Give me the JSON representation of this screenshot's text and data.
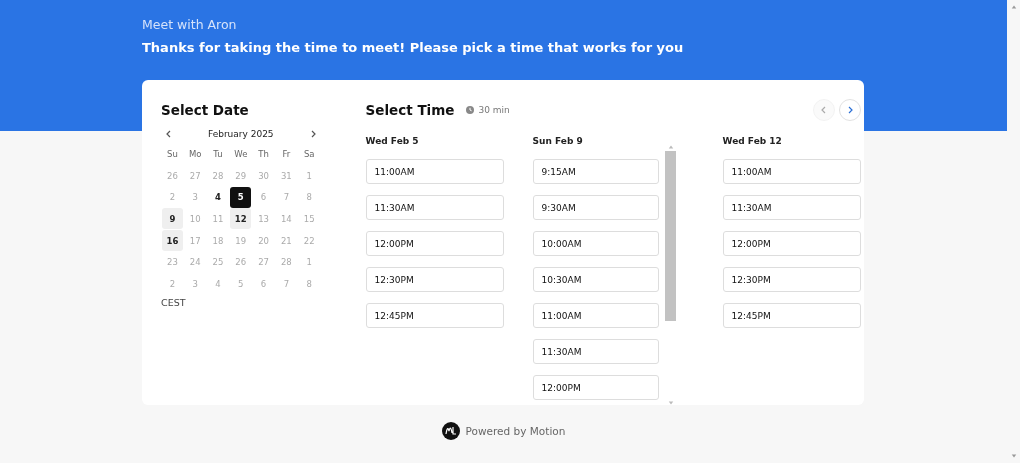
{
  "header": {
    "host": "Meet with Aron",
    "message": "Thanks for taking the time to meet! Please pick a time that works for you"
  },
  "date_picker": {
    "title": "Select Date",
    "month": "February 2025",
    "weekdays": [
      "Su",
      "Mo",
      "Tu",
      "We",
      "Th",
      "Fr",
      "Sa"
    ],
    "weeks": [
      [
        {
          "label": "26",
          "available": false,
          "selected": false,
          "highlighted": false
        },
        {
          "label": "27",
          "available": false,
          "selected": false,
          "highlighted": false
        },
        {
          "label": "28",
          "available": false,
          "selected": false,
          "highlighted": false
        },
        {
          "label": "29",
          "available": false,
          "selected": false,
          "highlighted": false
        },
        {
          "label": "30",
          "available": false,
          "selected": false,
          "highlighted": false
        },
        {
          "label": "31",
          "available": false,
          "selected": false,
          "highlighted": false
        },
        {
          "label": "1",
          "available": false,
          "selected": false,
          "highlighted": false
        }
      ],
      [
        {
          "label": "2",
          "available": false,
          "selected": false,
          "highlighted": false
        },
        {
          "label": "3",
          "available": false,
          "selected": false,
          "highlighted": false
        },
        {
          "label": "4",
          "available": true,
          "selected": false,
          "highlighted": false
        },
        {
          "label": "5",
          "available": true,
          "selected": true,
          "highlighted": false
        },
        {
          "label": "6",
          "available": false,
          "selected": false,
          "highlighted": false
        },
        {
          "label": "7",
          "available": false,
          "selected": false,
          "highlighted": false
        },
        {
          "label": "8",
          "available": false,
          "selected": false,
          "highlighted": false
        }
      ],
      [
        {
          "label": "9",
          "available": true,
          "selected": false,
          "highlighted": true
        },
        {
          "label": "10",
          "available": false,
          "selected": false,
          "highlighted": false
        },
        {
          "label": "11",
          "available": false,
          "selected": false,
          "highlighted": false
        },
        {
          "label": "12",
          "available": true,
          "selected": false,
          "highlighted": true
        },
        {
          "label": "13",
          "available": false,
          "selected": false,
          "highlighted": false
        },
        {
          "label": "14",
          "available": false,
          "selected": false,
          "highlighted": false
        },
        {
          "label": "15",
          "available": false,
          "selected": false,
          "highlighted": false
        }
      ],
      [
        {
          "label": "16",
          "available": true,
          "selected": false,
          "highlighted": true
        },
        {
          "label": "17",
          "available": false,
          "selected": false,
          "highlighted": false
        },
        {
          "label": "18",
          "available": false,
          "selected": false,
          "highlighted": false
        },
        {
          "label": "19",
          "available": false,
          "selected": false,
          "highlighted": false
        },
        {
          "label": "20",
          "available": false,
          "selected": false,
          "highlighted": false
        },
        {
          "label": "21",
          "available": false,
          "selected": false,
          "highlighted": false
        },
        {
          "label": "22",
          "available": false,
          "selected": false,
          "highlighted": false
        }
      ],
      [
        {
          "label": "23",
          "available": false,
          "selected": false,
          "highlighted": false
        },
        {
          "label": "24",
          "available": false,
          "selected": false,
          "highlighted": false
        },
        {
          "label": "25",
          "available": false,
          "selected": false,
          "highlighted": false
        },
        {
          "label": "26",
          "available": false,
          "selected": false,
          "highlighted": false
        },
        {
          "label": "27",
          "available": false,
          "selected": false,
          "highlighted": false
        },
        {
          "label": "28",
          "available": false,
          "selected": false,
          "highlighted": false
        },
        {
          "label": "1",
          "available": false,
          "selected": false,
          "highlighted": false
        }
      ],
      [
        {
          "label": "2",
          "available": false,
          "selected": false,
          "highlighted": false
        },
        {
          "label": "3",
          "available": false,
          "selected": false,
          "highlighted": false
        },
        {
          "label": "4",
          "available": false,
          "selected": false,
          "highlighted": false
        },
        {
          "label": "5",
          "available": false,
          "selected": false,
          "highlighted": false
        },
        {
          "label": "6",
          "available": false,
          "selected": false,
          "highlighted": false
        },
        {
          "label": "7",
          "available": false,
          "selected": false,
          "highlighted": false
        },
        {
          "label": "8",
          "available": false,
          "selected": false,
          "highlighted": false
        }
      ]
    ],
    "timezone": "CEST"
  },
  "time_picker": {
    "title": "Select Time",
    "duration": "30 min",
    "nav": [
      {
        "kind": "prev",
        "disabled": true
      },
      {
        "kind": "next",
        "disabled": false
      }
    ],
    "columns": [
      {
        "date": "Wed Feb 5",
        "scrollable": false,
        "slots": [
          "11:00AM",
          "11:30AM",
          "12:00PM",
          "12:30PM",
          "12:45PM"
        ]
      },
      {
        "date": "Sun Feb 9",
        "scrollable": true,
        "slots": [
          "9:15AM",
          "9:30AM",
          "10:00AM",
          "10:30AM",
          "11:00AM",
          "11:30AM",
          "12:00PM"
        ]
      },
      {
        "date": "Wed Feb 12",
        "scrollable": false,
        "slots": [
          "11:00AM",
          "11:30AM",
          "12:00PM",
          "12:30PM",
          "12:45PM"
        ]
      }
    ]
  },
  "footer": {
    "text": "Powered by Motion"
  }
}
